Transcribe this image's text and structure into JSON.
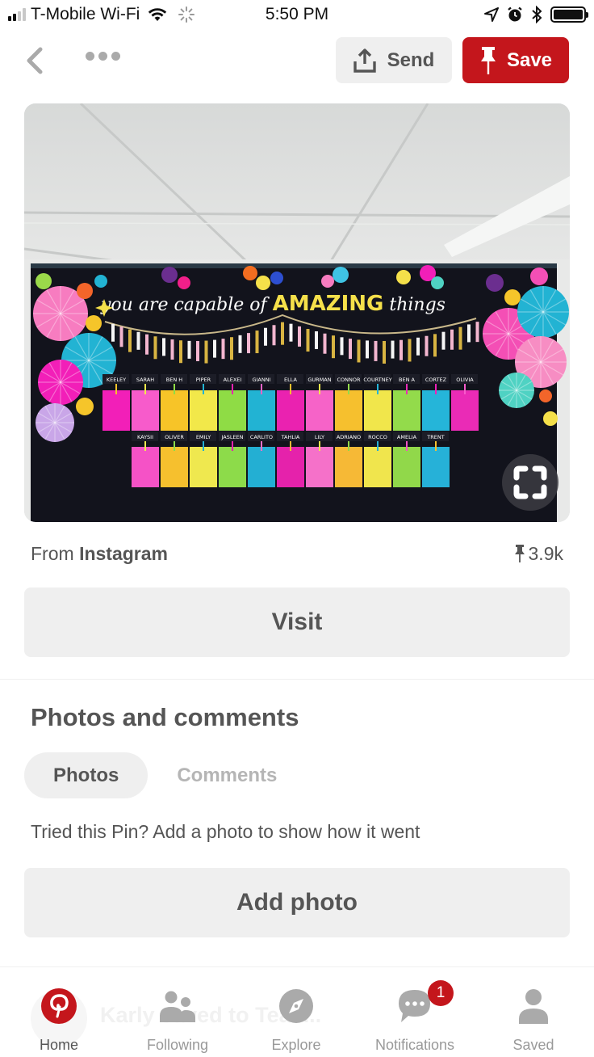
{
  "status_bar": {
    "carrier": "T-Mobile Wi-Fi",
    "time": "5:50 PM",
    "signal_bars_filled": 2,
    "signal_bars_total": 4,
    "battery_level": 0.95
  },
  "toolbar": {
    "back_icon": "chevron-left-icon",
    "more_icon": "ellipsis-icon",
    "send_label": "Send",
    "save_label": "Save"
  },
  "colors": {
    "brand_red": "#c4161c",
    "button_gray": "#efefef",
    "text_gray": "#555555",
    "muted_gray": "#b5b5b5"
  },
  "pin": {
    "image_description": "Classroom bulletin board: you are capable of AMAZING things",
    "board_banner_prefix": "you are capable of",
    "board_banner_highlight": "AMAZING",
    "board_banner_suffix": "things",
    "row1_names": [
      "KEELEY",
      "SARAH",
      "BEN H",
      "PIPER",
      "ALEXEI",
      "GIANNI",
      "ELLA",
      "GURMAN",
      "CONNOR",
      "COURTNEY",
      "BEN A",
      "CORTEZ",
      "OLIVIA"
    ],
    "row2_names": [
      "KAYSII",
      "OLIVER",
      "EMILY",
      "JASLEEN",
      "CARLITO",
      "TAHLIA",
      "LILY",
      "ADRIANO",
      "ROCCO",
      "AMELIA",
      "TRENT"
    ],
    "row1_colors": [
      "#f21fb8",
      "#f75bcb",
      "#f7c428",
      "#f2e84a",
      "#8fdc45",
      "#22b3d3",
      "#ea22b0",
      "#f663c8",
      "#f6c02e",
      "#f1e64b",
      "#93db4b",
      "#25b5d9",
      "#ea2bb6"
    ],
    "row2_colors": [
      "#f552c6",
      "#f6c02e",
      "#efe84f",
      "#8ddb4a",
      "#23afd3",
      "#e522ab",
      "#f571c9",
      "#f6b936",
      "#f0e54d",
      "#91d84a",
      "#26b1d8"
    ]
  },
  "source": {
    "prefix": "From",
    "name": "Instagram",
    "save_count": "3.9k"
  },
  "visit_label": "Visit",
  "photos_section": {
    "title": "Photos and comments",
    "tabs": [
      {
        "label": "Photos",
        "active": true
      },
      {
        "label": "Comments",
        "active": false
      }
    ],
    "prompt": "Tried this Pin? Add a photo to show how it went",
    "add_photo_label": "Add photo"
  },
  "background_activity": "Karly saved to Teac...",
  "bottom_nav": {
    "items": [
      {
        "label": "Home",
        "icon": "pinterest-logo-icon",
        "active": true
      },
      {
        "label": "Following",
        "icon": "people-icon",
        "active": false
      },
      {
        "label": "Explore",
        "icon": "compass-icon",
        "active": false
      },
      {
        "label": "Notifications",
        "icon": "chat-bubble-icon",
        "active": false,
        "badge": "1"
      },
      {
        "label": "Saved",
        "icon": "person-icon",
        "active": false
      }
    ]
  }
}
